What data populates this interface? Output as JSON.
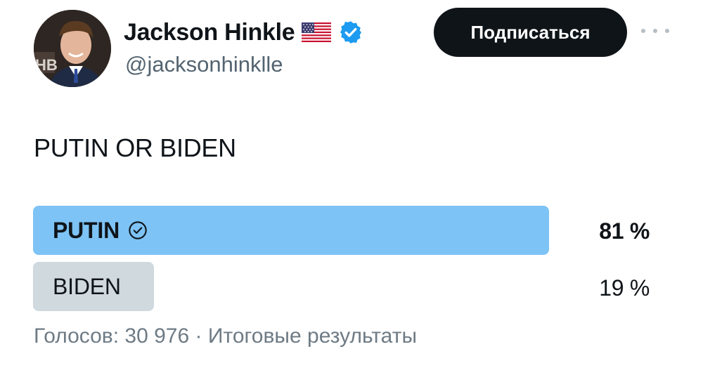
{
  "author": {
    "display_name": "Jackson Hinkle",
    "handle": "@jacksonhinklle",
    "flag_icon": "us-flag-icon",
    "verified_icon": "verified-badge-icon",
    "avatar_backdrop_text": "HB"
  },
  "follow_button": {
    "label": "Подписаться"
  },
  "more_menu_icon": "more-horizontal-icon",
  "tweet": {
    "text": "PUTIN OR BIDEN"
  },
  "poll": {
    "options": [
      {
        "label": "PUTIN",
        "percent_label": "81 %",
        "share": 0.81,
        "winner": true,
        "check_icon": "check-circle-icon"
      },
      {
        "label": "BIDEN",
        "percent_label": "19 %",
        "share": 0.19,
        "winner": false
      }
    ],
    "votes_label": "Голосов: 30 976",
    "separator": "·",
    "status_label": "Итоговые результаты"
  },
  "colors": {
    "winner_bar": "#7dc3f5",
    "loser_bar": "#cfd9de",
    "follow_button_bg": "#0f1419",
    "verified_blue": "#1d9bf0",
    "secondary_text": "#536471"
  }
}
